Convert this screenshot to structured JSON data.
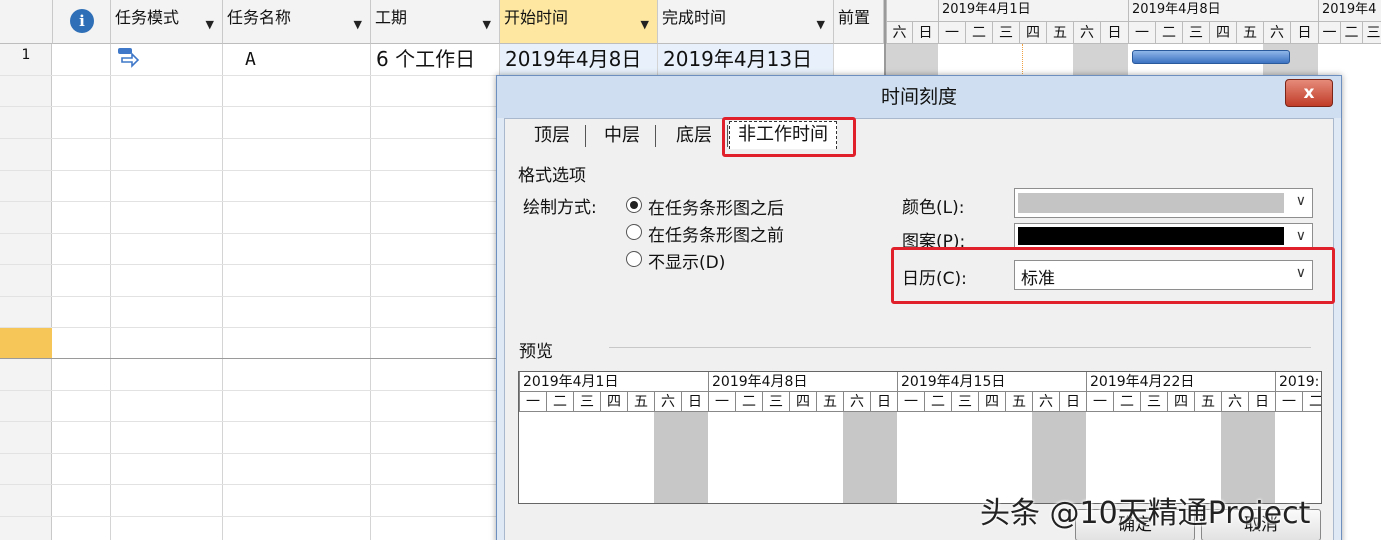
{
  "grid": {
    "headers": {
      "mode": "任务模式",
      "name": "任务名称",
      "duration": "工期",
      "start": "开始时间",
      "finish": "完成时间",
      "pred": "前置"
    },
    "row": {
      "num": "1",
      "name": "A",
      "duration": "6 个工作日",
      "start": "2019年4月8日",
      "finish": "2019年4月13日"
    }
  },
  "gantt": {
    "weeks": [
      "2019年4月1日",
      "2019年4月8日",
      "2019年4"
    ],
    "days": [
      "六",
      "日",
      "一",
      "二",
      "三",
      "四",
      "五",
      "六",
      "日",
      "一",
      "二",
      "三",
      "四",
      "五",
      "六",
      "日",
      "一",
      "二",
      "三"
    ]
  },
  "dialog": {
    "title": "时间刻度",
    "close": "x",
    "tabs": [
      "顶层",
      "中层",
      "底层",
      "非工作时间"
    ],
    "format_options": "格式选项",
    "draw_label": "绘制方式:",
    "options": [
      "在任务条形图之后",
      "在任务条形图之前",
      "不显示(D)"
    ],
    "selected_option": 0,
    "color_label": "颜色(L):",
    "pattern_label": "图案(P):",
    "calendar_label": "日历(C):",
    "calendar_value": "标准",
    "colors": {
      "color_swatch": "#c4c4c4",
      "pattern_swatch": "#000000",
      "highlight": "#e0202a"
    },
    "preview_label": "预览",
    "preview_weeks": [
      "2019年4月1日",
      "2019年4月8日",
      "2019年4月15日",
      "2019年4月22日",
      "2019:"
    ],
    "preview_days": [
      "一",
      "二",
      "三",
      "四",
      "五",
      "六",
      "日",
      "一",
      "二",
      "三",
      "四",
      "五",
      "六",
      "日",
      "一",
      "二",
      "三",
      "四",
      "五",
      "六",
      "日",
      "一",
      "二",
      "三",
      "四",
      "五",
      "六",
      "日",
      "一",
      "二"
    ],
    "ok": "确定",
    "cancel": "取消"
  },
  "watermark": "头条 @10天精通Project"
}
